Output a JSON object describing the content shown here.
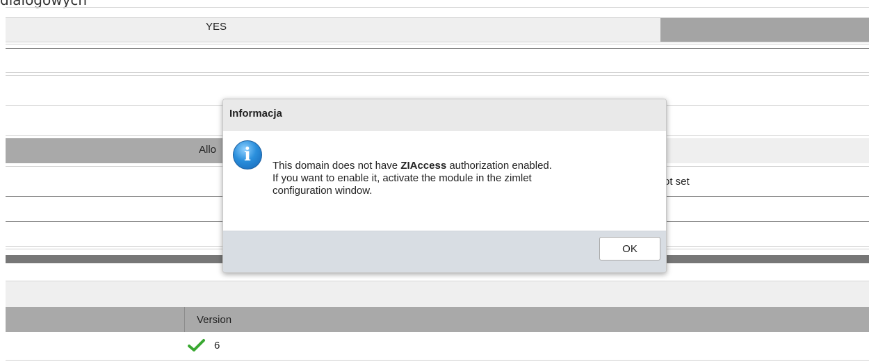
{
  "page": {
    "top_text": "dialogowych",
    "yes_label": "YES",
    "allow_label": "Allo",
    "not_set_label": "ot set"
  },
  "table": {
    "header_version": "Version",
    "row_value": "6",
    "row_icon": "check-icon"
  },
  "dialog": {
    "title": "Informacja",
    "icon": "info-icon",
    "message_part1": "This domain does not have ",
    "message_bold": "ZIAccess",
    "message_part2": " authorization enabled.",
    "message_line2": "If you want to enable it, activate the module in the zimlet",
    "message_line3": "configuration window.",
    "ok_label": "OK"
  },
  "colors": {
    "icon_blue": "#2a8fdc",
    "check_green": "#3aa832",
    "footer_bg": "#d8dde3"
  }
}
